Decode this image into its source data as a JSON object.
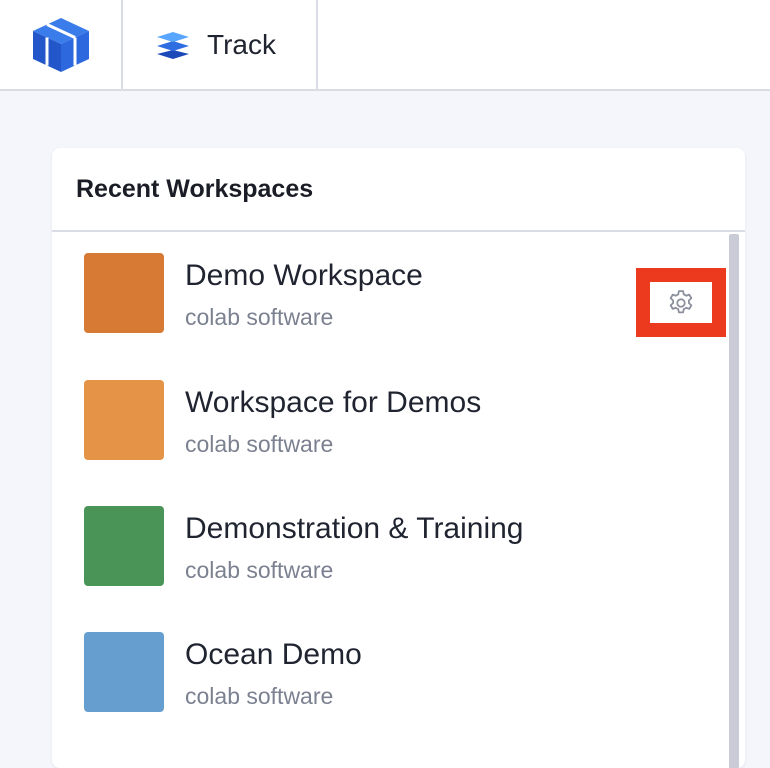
{
  "header": {
    "app_tab_label": "Track"
  },
  "workspaces": {
    "title": "Recent Workspaces",
    "items": [
      {
        "name": "Demo Workspace",
        "org": "colab software",
        "color": "#d77a33",
        "settings_icon": "gear-icon"
      },
      {
        "name": "Workspace for Demos",
        "org": "colab software",
        "color": "#e59346"
      },
      {
        "name": "Demonstration & Training",
        "org": "colab software",
        "color": "#4a9457"
      },
      {
        "name": "Ocean Demo",
        "org": "colab software",
        "color": "#659ecf"
      }
    ]
  },
  "colors": {
    "highlight": "#ec3a1e",
    "logo_blue": "#2f6ee0"
  }
}
